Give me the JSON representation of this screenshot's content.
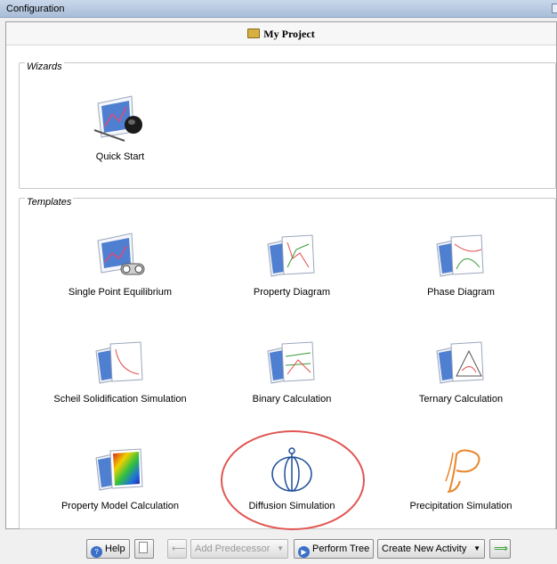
{
  "window": {
    "title": "Configuration"
  },
  "project": {
    "title": "My Project",
    "icon": "folder-icon"
  },
  "wizards": {
    "legend": "Wizards",
    "items": [
      {
        "label": "Quick Start",
        "icon": "quick-start-icon"
      }
    ]
  },
  "templates": {
    "legend": "Templates",
    "items": [
      {
        "label": "Single Point Equilibrium",
        "icon": "single-point-equilibrium-icon"
      },
      {
        "label": "Property Diagram",
        "icon": "property-diagram-icon"
      },
      {
        "label": "Phase Diagram",
        "icon": "phase-diagram-icon"
      },
      {
        "label": "Scheil Solidification Simulation",
        "icon": "scheil-icon"
      },
      {
        "label": "Binary Calculation",
        "icon": "binary-calculation-icon"
      },
      {
        "label": "Ternary Calculation",
        "icon": "ternary-calculation-icon"
      },
      {
        "label": "Property Model Calculation",
        "icon": "property-model-icon"
      },
      {
        "label": "Diffusion Simulation",
        "icon": "diffusion-simulation-icon"
      },
      {
        "label": "Precipitation Simulation",
        "icon": "precipitation-simulation-icon"
      }
    ]
  },
  "toolbar": {
    "help": "Help",
    "add_predecessor": "Add Predecessor",
    "perform_tree": "Perform Tree",
    "create_new_activity": "Create New Activity"
  },
  "colors": {
    "selection_ring": "#e05552",
    "diffusion_icon": "#1f4e9a",
    "precipitation_icon": "#e8862a"
  }
}
